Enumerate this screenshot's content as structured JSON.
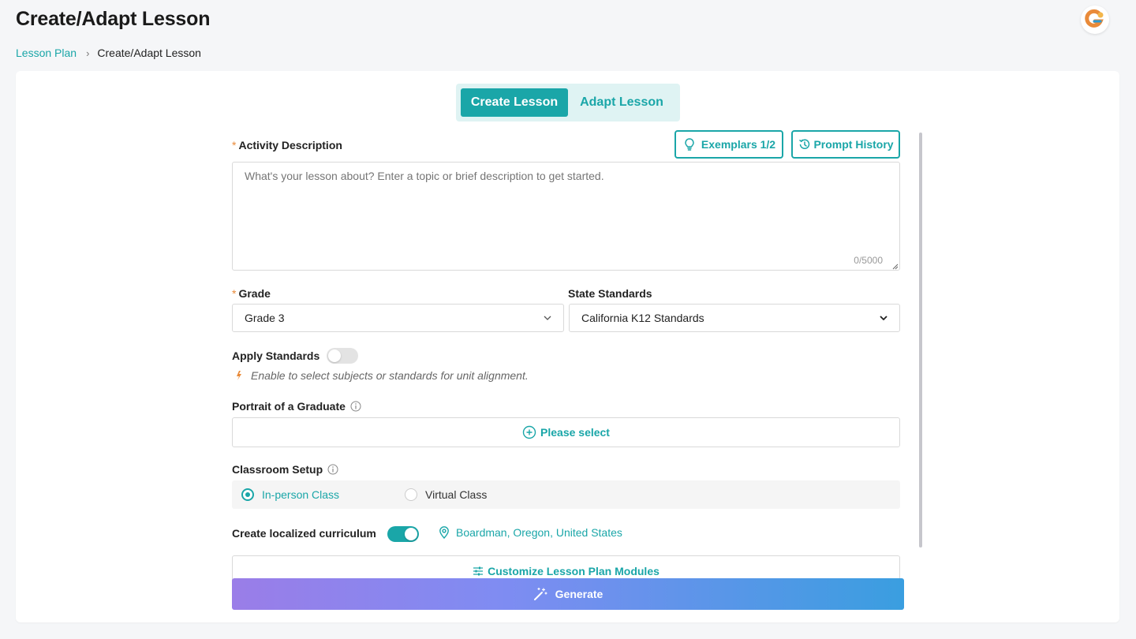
{
  "header": {
    "title": "Create/Adapt Lesson"
  },
  "breadcrumb": {
    "parent": "Lesson Plan",
    "separator": "›",
    "current": "Create/Adapt Lesson"
  },
  "tabs": [
    {
      "label": "Create Lesson",
      "active": true
    },
    {
      "label": "Adapt Lesson",
      "active": false
    }
  ],
  "activity": {
    "required_mark": "*",
    "label": "Activity Description",
    "placeholder": "What's your lesson about? Enter a topic or brief description to get started.",
    "value": "",
    "counter": "0/5000"
  },
  "actions": {
    "exemplars_label": "Exemplars 1/2",
    "prompt_history_label": "Prompt History"
  },
  "grade": {
    "required_mark": "*",
    "label": "Grade",
    "value": "Grade 3"
  },
  "state_standards": {
    "label": "State Standards",
    "value": "California K12 Standards"
  },
  "apply_standards": {
    "label": "Apply Standards",
    "enabled": false,
    "hint": "Enable to select subjects or standards for unit alignment."
  },
  "portrait": {
    "label": "Portrait of a Graduate",
    "placeholder": "Please select"
  },
  "classroom_setup": {
    "label": "Classroom Setup",
    "options": [
      {
        "label": "In-person Class",
        "selected": true
      },
      {
        "label": "Virtual Class",
        "selected": false
      }
    ]
  },
  "localized": {
    "label": "Create localized curriculum",
    "enabled": true,
    "location": "Boardman, Oregon, United States"
  },
  "customize_label": "Customize Lesson Plan Modules",
  "generate_label": "Generate",
  "colors": {
    "accent": "#1aa6a8",
    "required": "#e98a39",
    "gradient_start": "#9a7de8",
    "gradient_end": "#3a9ee0"
  }
}
